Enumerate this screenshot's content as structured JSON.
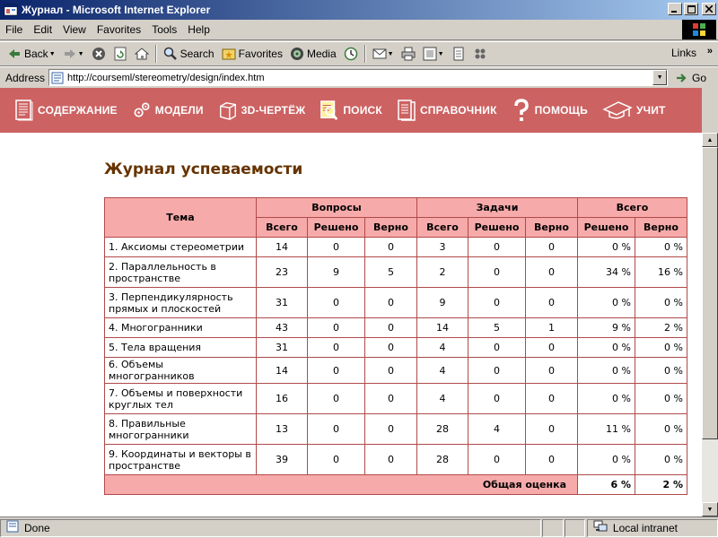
{
  "window": {
    "title": "Журнал - Microsoft Internet Explorer",
    "minimize_icon": "minimize-icon",
    "maximize_icon": "maximize-icon",
    "close_icon": "close-icon"
  },
  "menu": {
    "items": [
      "File",
      "Edit",
      "View",
      "Favorites",
      "Tools",
      "Help"
    ],
    "links_label": "Links"
  },
  "toolbar": {
    "back_label": "Back",
    "search_label": "Search",
    "favorites_label": "Favorites",
    "media_label": "Media"
  },
  "address": {
    "label": "Address",
    "url": "http://courseml/stereometry/design/index.htm",
    "go_label": "Go"
  },
  "site_nav": {
    "items": [
      {
        "label": "СОДЕРЖАНИЕ",
        "icon": "book-icon"
      },
      {
        "label": "МОДЕЛИ",
        "icon": "gears-icon"
      },
      {
        "label": "3D-ЧЕРТЁЖ",
        "icon": "cube-icon"
      },
      {
        "label": "ПОИСК",
        "icon": "magnifier-icon"
      },
      {
        "label": "СПРАВОЧНИК",
        "icon": "handbook-icon"
      },
      {
        "label": "ПОМОЩЬ",
        "icon": "question-icon"
      },
      {
        "label": "УЧИТ",
        "icon": "graduation-cap-icon"
      }
    ],
    "background": "#cd6262"
  },
  "page": {
    "title": "Журнал успеваемости",
    "title_color": "#663300"
  },
  "table": {
    "header": {
      "topic": "Тема",
      "questions": "Вопросы",
      "tasks": "Задачи",
      "total": "Всего",
      "q_total": "Всего",
      "q_solved": "Решено",
      "q_correct": "Верно",
      "t_total": "Всего",
      "t_solved": "Решено",
      "t_correct": "Верно",
      "sum_solved": "Решено",
      "sum_correct": "Верно"
    },
    "rows": [
      {
        "topic": "1. Аксиомы стереометрии",
        "q_total": "14",
        "q_solved": "0",
        "q_correct": "0",
        "t_total": "3",
        "t_solved": "0",
        "t_correct": "0",
        "solved_pct": "0 %",
        "correct_pct": "0 %"
      },
      {
        "topic": "2. Параллельность в пространстве",
        "q_total": "23",
        "q_solved": "9",
        "q_correct": "5",
        "t_total": "2",
        "t_solved": "0",
        "t_correct": "0",
        "solved_pct": "34 %",
        "correct_pct": "16 %"
      },
      {
        "topic": "3. Перпендикулярность прямых и плоскостей",
        "q_total": "31",
        "q_solved": "0",
        "q_correct": "0",
        "t_total": "9",
        "t_solved": "0",
        "t_correct": "0",
        "solved_pct": "0 %",
        "correct_pct": "0 %"
      },
      {
        "topic": "4. Многогранники",
        "q_total": "43",
        "q_solved": "0",
        "q_correct": "0",
        "t_total": "14",
        "t_solved": "5",
        "t_correct": "1",
        "solved_pct": "9 %",
        "correct_pct": "2 %"
      },
      {
        "topic": "5. Тела вращения",
        "q_total": "31",
        "q_solved": "0",
        "q_correct": "0",
        "t_total": "4",
        "t_solved": "0",
        "t_correct": "0",
        "solved_pct": "0 %",
        "correct_pct": "0 %"
      },
      {
        "topic": "6. Объемы многогранников",
        "q_total": "14",
        "q_solved": "0",
        "q_correct": "0",
        "t_total": "4",
        "t_solved": "0",
        "t_correct": "0",
        "solved_pct": "0 %",
        "correct_pct": "0 %"
      },
      {
        "topic": "7. Объемы и поверхности круглых тел",
        "q_total": "16",
        "q_solved": "0",
        "q_correct": "0",
        "t_total": "4",
        "t_solved": "0",
        "t_correct": "0",
        "solved_pct": "0 %",
        "correct_pct": "0 %"
      },
      {
        "topic": "8. Правильные многогранники",
        "q_total": "13",
        "q_solved": "0",
        "q_correct": "0",
        "t_total": "28",
        "t_solved": "4",
        "t_correct": "0",
        "solved_pct": "11 %",
        "correct_pct": "0 %"
      },
      {
        "topic": "9. Координаты и векторы в пространстве",
        "q_total": "39",
        "q_solved": "0",
        "q_correct": "0",
        "t_total": "28",
        "t_solved": "0",
        "t_correct": "0",
        "solved_pct": "0 %",
        "correct_pct": "0 %"
      }
    ],
    "total_label": "Общая оценка",
    "total_solved": "6 %",
    "total_correct": "2 %",
    "header_bg": "#f7aaaa",
    "border_color": "#b04a4a"
  },
  "status": {
    "text": "Done",
    "zone": "Local intranet"
  }
}
